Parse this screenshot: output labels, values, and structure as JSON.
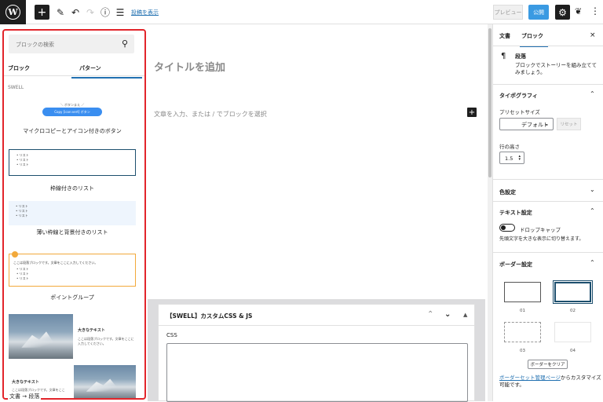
{
  "toolbar": {
    "link": "投稿を表示",
    "preview": "プレビュー",
    "publish": "公開",
    "wp_icon": "wordpress-logo",
    "icons": [
      "add-block",
      "edit-pencil",
      "undo",
      "redo",
      "info",
      "list-view"
    ]
  },
  "inserter": {
    "search_placeholder": "ブロックの検索",
    "tab_blocks": "ブロック",
    "tab_patterns": "パターン",
    "category": "SWELL",
    "patterns": [
      {
        "title": "マイクロコピーとアイコン付きのボタン",
        "microcopy": "＼ ボタンまえ ／",
        "button": "Copy [icon:vert] ボタン"
      },
      {
        "title": "枠線付きのリスト",
        "items": [
          "リスト",
          "リスト",
          "リスト"
        ]
      },
      {
        "title": "薄い枠線と背景付きのリスト",
        "items": [
          "リスト",
          "リスト",
          "リスト"
        ]
      },
      {
        "title": "ポイントグループ",
        "text": "ここは段落ブロックです。文章をここに入力してください。",
        "items": [
          "リスト",
          "リスト",
          "リスト"
        ]
      },
      {
        "heading": "大きなテキスト",
        "text": "ここは段落ブロックです。文章をここに入力してください。"
      },
      {
        "heading": "大きなテキスト",
        "text": "ここは段落ブロックです。文章をここ"
      }
    ]
  },
  "breadcrumb": {
    "doc": "文書",
    "sep": "→",
    "block": "段落"
  },
  "editor": {
    "title_placeholder": "タイトルを追加",
    "body_placeholder": "文章を入力、または / でブロックを選択"
  },
  "metabox": {
    "title": "【SWELL】カスタムCSS & JS",
    "css_label": "CSS"
  },
  "sidebar": {
    "tab_doc": "文書",
    "tab_block": "ブロック",
    "close": "×",
    "block_name": "段落",
    "block_desc": "ブロックでストーリーを組み立ててみましょう。",
    "typography": "タイポグラフィ",
    "preset_size": "プリセットサイズ",
    "preset_value": "デフォルト",
    "reset": "リセット",
    "line_height": "行の高さ",
    "line_height_value": "1.5",
    "color": "色設定",
    "text": "テキスト設定",
    "dropcap": "ドロップキャップ",
    "dropcap_help": "先頭文字を大きな表示に切り替えます。",
    "border": "ボーダー設定",
    "borders": [
      "01",
      "02",
      "03",
      "04"
    ],
    "clear": "ボーダーをクリア",
    "border_link": "ボーダーセット管理ページ",
    "border_link_after": "からカスタマイズ可能です。"
  }
}
